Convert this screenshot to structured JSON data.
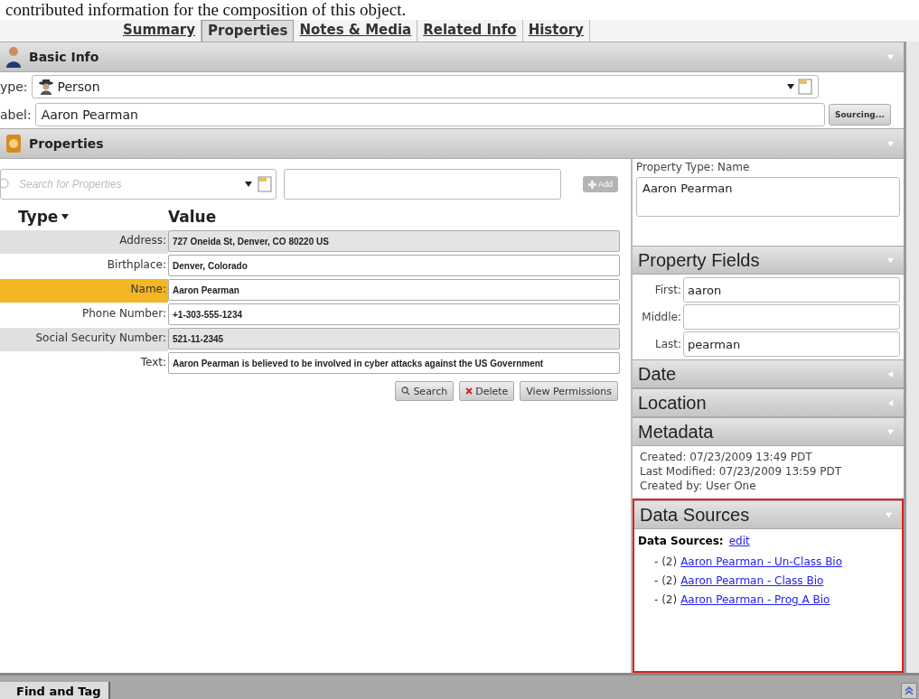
{
  "caption": "contributed information for the composition of this object.",
  "tabs": [
    {
      "label": "Summary",
      "selected": false
    },
    {
      "label": "Properties",
      "selected": true
    },
    {
      "label": "Notes & Media",
      "selected": false
    },
    {
      "label": "Related Info",
      "selected": false
    },
    {
      "label": "History",
      "selected": false
    }
  ],
  "basic_info": {
    "title": "Basic Info",
    "expanded": true,
    "type_label": "ype:",
    "type_value": "Person",
    "label_label": "abel:",
    "label_value": "Aaron Pearman",
    "sourcing_button": "Sourcing..."
  },
  "properties": {
    "title": "Properties",
    "expanded": true,
    "search": {
      "placeholder": "Search for Properties"
    },
    "add_button": {
      "label": "Add",
      "disabled": true
    },
    "columns": [
      "Type",
      "Value"
    ],
    "rows": [
      {
        "type": "Address:",
        "value": "727 Oneida St, Denver, CO 80220 US",
        "selected": false,
        "shaded": true
      },
      {
        "type": "Birthplace:",
        "value": "Denver, Colorado",
        "selected": false,
        "shaded": false
      },
      {
        "type": "Name:",
        "value": "Aaron Pearman",
        "selected": true,
        "shaded": false
      },
      {
        "type": "Phone Number:",
        "value": "+1-303-555-1234",
        "selected": false,
        "shaded": false
      },
      {
        "type": "Social Security Number:",
        "value": "521-11-2345",
        "selected": false,
        "shaded": true
      },
      {
        "type": "Text:",
        "value": "Aaron Pearman is believed to be involved in cyber attacks against the US Government",
        "selected": false,
        "shaded": false
      }
    ],
    "buttons": [
      {
        "label": "Search",
        "kind": "search"
      },
      {
        "label": "Delete",
        "kind": "delete"
      },
      {
        "label": "View Permissions",
        "kind": "plain"
      }
    ]
  },
  "detail": {
    "property_type": "Property Type: Name",
    "value": "Aaron Pearman",
    "sections": [
      {
        "title": "Property Fields",
        "expanded": true,
        "kind": "fields",
        "fields": [
          {
            "label": "First:",
            "value": "aaron"
          },
          {
            "label": "Middle:"
          },
          {
            "label": "Last:",
            "value": "pearman"
          }
        ]
      },
      {
        "title": "Date",
        "expanded": false
      },
      {
        "title": "Location",
        "expanded": false
      },
      {
        "title": "Metadata",
        "expanded": true,
        "kind": "lines",
        "lines": [
          "Created: 07/23/2009 13:49 PDT",
          "Last Modified: 07/23/2009 13:59 PDT",
          "Created by: User One"
        ]
      },
      {
        "title": "Data Sources",
        "expanded": true,
        "kind": "sources",
        "highlighted": true,
        "heading": "Data Sources:",
        "edit_link": "edit",
        "items": [
          {
            "count": "- (2)",
            "link": "Aaron Pearman  - Un-Class Bio"
          },
          {
            "count": "- (2)",
            "link": "Aaron Pearman - Class Bio"
          },
          {
            "count": "- (2)",
            "link": "Aaron Pearman - Prog A Bio"
          }
        ]
      }
    ]
  },
  "bottom_tab": "Find and Tag"
}
